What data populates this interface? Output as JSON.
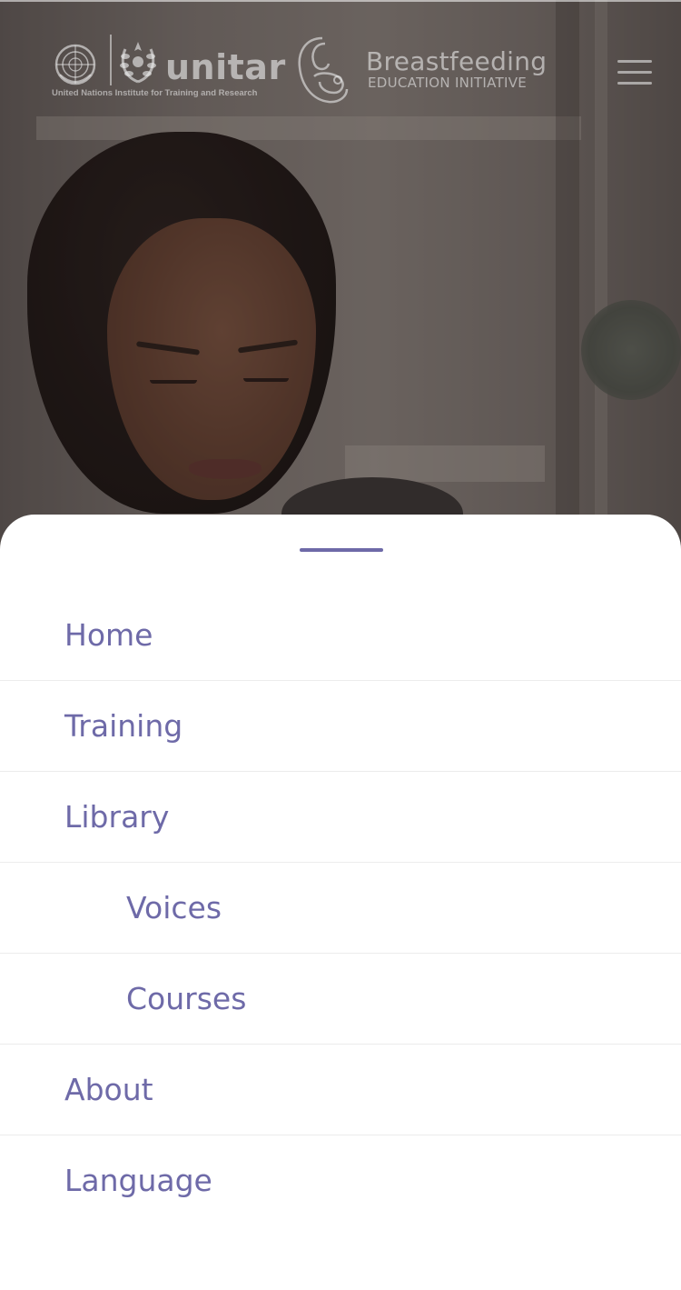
{
  "header": {
    "unitar_wordmark": "unitar",
    "unitar_subtitle": "United Nations Institute for Training and Research",
    "program_title": "Breastfeeding",
    "program_subtitle": "EDUCATION INITIATIVE",
    "icons": {
      "un_emblem": "un-emblem-icon",
      "unitar_wreath": "unitar-wreath-icon",
      "program_logo": "mother-child-icon",
      "menu": "hamburger-menu-icon"
    }
  },
  "hero": {
    "image": "woman-looking-down-photo"
  },
  "menu": {
    "items": [
      {
        "label": "Home"
      },
      {
        "label": "Training"
      },
      {
        "label": "Library"
      },
      {
        "label": "Voices"
      },
      {
        "label": "Courses"
      },
      {
        "label": "About"
      },
      {
        "label": "Language"
      }
    ]
  },
  "colors": {
    "menu_text": "#6e6aa8",
    "divider": "#ececec",
    "sheet_background": "#ffffff",
    "logo_overlay": "#ebebeb"
  }
}
